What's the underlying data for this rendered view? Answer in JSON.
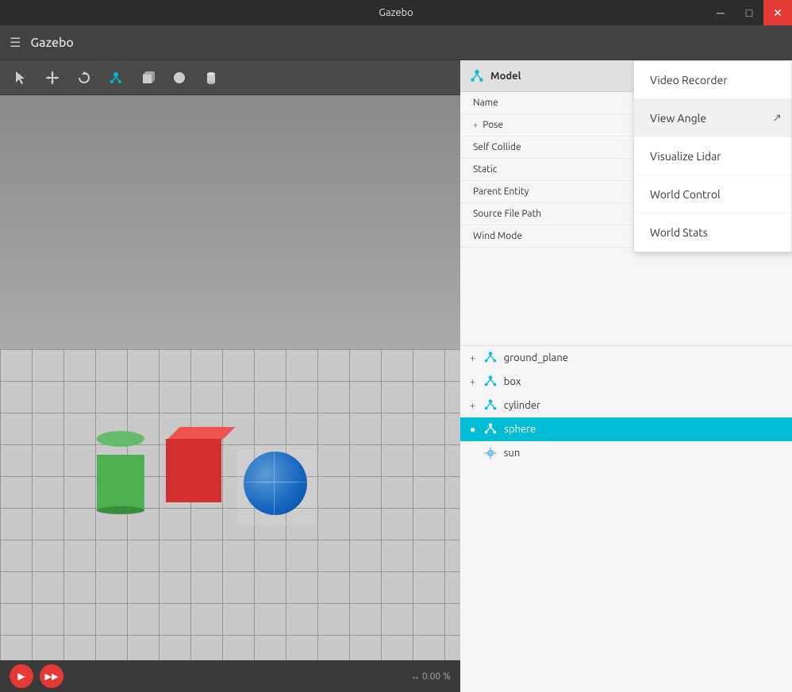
{
  "titlebar": {
    "title": "Gazebo",
    "minimize_label": "─",
    "maximize_label": "□",
    "close_label": "✕"
  },
  "header": {
    "app_name": "Gazebo"
  },
  "toolbar": {
    "tools": [
      {
        "name": "select",
        "icon": "↖",
        "label": "select-tool"
      },
      {
        "name": "translate",
        "icon": "✛",
        "label": "translate-tool"
      },
      {
        "name": "rotate",
        "icon": "↺",
        "label": "rotate-tool"
      },
      {
        "name": "shape-model",
        "icon": "🔷",
        "label": "shape-model-tool"
      },
      {
        "name": "box",
        "icon": "■",
        "label": "box-tool"
      },
      {
        "name": "sphere",
        "icon": "●",
        "label": "sphere-tool"
      },
      {
        "name": "cylinder",
        "icon": "⬬",
        "label": "cylinder-tool"
      }
    ]
  },
  "viewport": {
    "zoom_percent": "0.00 %"
  },
  "playback": {
    "play_label": "▶",
    "ff_label": "▶▶"
  },
  "inspector": {
    "title": "Model",
    "name_label": "Name",
    "pose_label": "Pose",
    "self_collide_label": "Self Collide",
    "static_label": "Static",
    "parent_entity_label": "Parent Entity",
    "source_file_label": "Source File Path",
    "wind_mode_label": "Wind Mode"
  },
  "scene_tree": {
    "items": [
      {
        "id": "ground_plane",
        "label": "ground_plane",
        "type": "node",
        "expandable": true,
        "selected": false
      },
      {
        "id": "box",
        "label": "box",
        "type": "node",
        "expandable": true,
        "selected": false
      },
      {
        "id": "cylinder",
        "label": "cylinder",
        "type": "node",
        "expandable": true,
        "selected": false
      },
      {
        "id": "sphere",
        "label": "sphere",
        "type": "node",
        "expandable": true,
        "selected": true
      },
      {
        "id": "sun",
        "label": "sun",
        "type": "light",
        "expandable": false,
        "selected": false
      }
    ]
  },
  "dropdown_menu": {
    "items": [
      {
        "id": "video-recorder",
        "label": "Video Recorder"
      },
      {
        "id": "view-angle",
        "label": "View Angle"
      },
      {
        "id": "visualize-lidar",
        "label": "Visualize Lidar"
      },
      {
        "id": "world-control",
        "label": "World Control"
      },
      {
        "id": "world-stats",
        "label": "World Stats"
      }
    ]
  },
  "cursor": {
    "symbol": "↗"
  }
}
